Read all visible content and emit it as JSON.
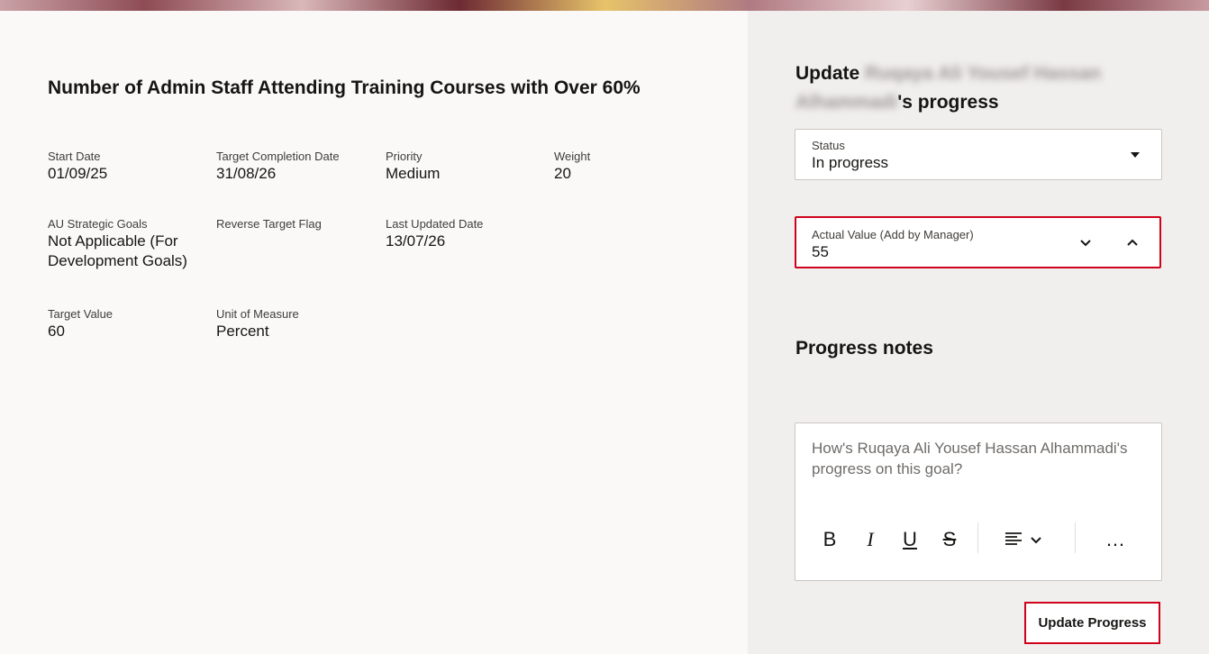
{
  "goal": {
    "title": "Number of Admin Staff Attending Training Courses with Over 60%",
    "fields": [
      {
        "label": "Start Date",
        "value": "01/09/25"
      },
      {
        "label": "Target Completion Date",
        "value": "31/08/26"
      },
      {
        "label": "Priority",
        "value": "Medium"
      },
      {
        "label": "Weight",
        "value": "20"
      },
      {
        "label": "AU Strategic Goals",
        "value": "Not Applicable (For Development Goals)"
      },
      {
        "label": "Reverse Target Flag",
        "value": ""
      },
      {
        "label": "Last Updated Date",
        "value": "13/07/26"
      },
      {
        "label": "Target Value",
        "value": "60"
      },
      {
        "label": "Unit of Measure",
        "value": "Percent"
      }
    ]
  },
  "update_panel": {
    "title_prefix": "Update",
    "person_name": "Ruqaya Ali Yousef Hassan Alhammadi",
    "title_suffix": "'s progress",
    "status": {
      "label": "Status",
      "value": "In progress"
    },
    "actual_value": {
      "label": "Actual Value (Add by Manager)",
      "value": "55"
    },
    "notes": {
      "heading": "Progress notes",
      "placeholder": "How's Ruqaya Ali Yousef Hassan Alhammadi's progress on this goal?"
    },
    "toolbar": {
      "bold": "B",
      "italic": "I",
      "underline": "U",
      "strike": "S",
      "more": "…"
    },
    "update_button": "Update Progress"
  }
}
